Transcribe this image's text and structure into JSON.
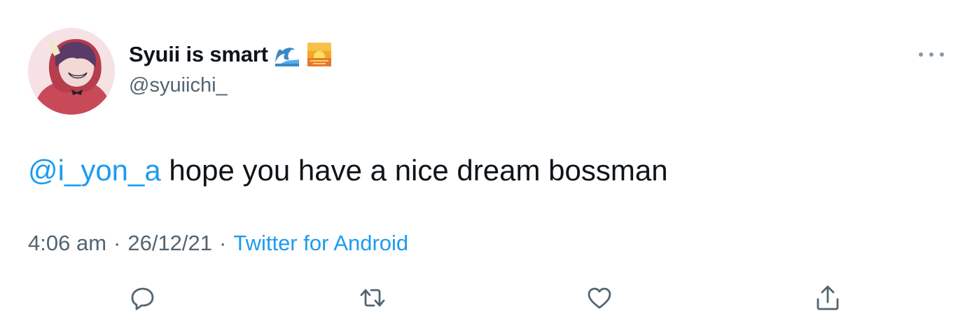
{
  "author": {
    "display_name": "Syuii is smart",
    "name_emojis": [
      "water-wave-emoji",
      "sunrise-emoji"
    ],
    "handle": "@syuiichi_"
  },
  "tweet": {
    "mention": "@i_yon_a",
    "text": " hope you have a nice dream bossman"
  },
  "meta": {
    "time": "4:06 am",
    "separator": "·",
    "date": "26/12/21",
    "source": "Twitter for Android"
  },
  "actions": [
    "reply-icon",
    "retweet-icon",
    "like-icon",
    "share-icon"
  ],
  "colors": {
    "text": "#0f1419",
    "secondary": "#536471",
    "link": "#1d9bf0",
    "background": "#ffffff"
  }
}
